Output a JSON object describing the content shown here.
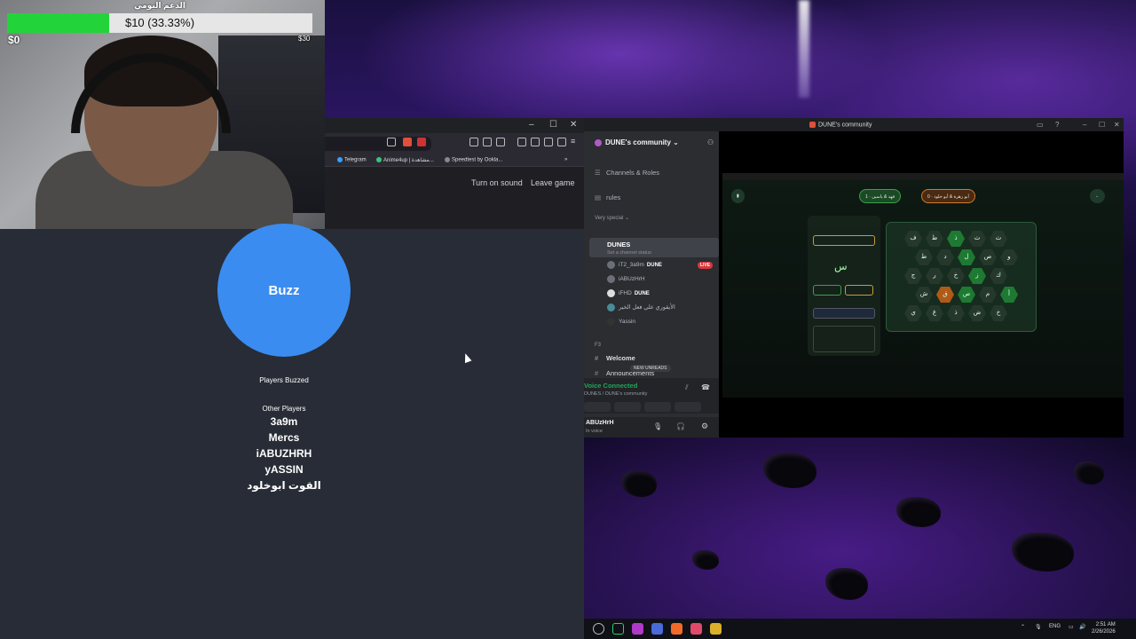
{
  "donation": {
    "title": "الدعم اليومي",
    "amount_text": "$10 (33.33%)",
    "progress_percent": 33.33,
    "min_label": "$0",
    "max_label": "$30"
  },
  "browser": {
    "bookmarks": [
      "Telegram",
      "Anime4up | مشاهدة...",
      "Speedtest by Ookla..."
    ],
    "window_controls": {
      "minimize": "–",
      "maximize": "☐",
      "close": "✕"
    }
  },
  "game": {
    "turn_on_sound": "Turn on sound",
    "leave_game": "Leave game",
    "buzz_label": "Buzz",
    "players_buzzed_label": "Players Buzzed",
    "other_players_label": "Other Players",
    "other_players": [
      "3a9m",
      "Mercs",
      "iABUZHRH",
      "yASSIN",
      "القوت ابوخلود"
    ]
  },
  "discord": {
    "window_title": "DUNE's community",
    "server_name": "DUNE's community",
    "channels_roles": "Channels & Roles",
    "rules": "rules",
    "category_very_special": "Very special",
    "active_channel": "DUNES",
    "channel_status_placeholder": "Set a channel status",
    "voice_users": [
      {
        "name": "iT2_3a9m",
        "tag": "DUNE",
        "live": true
      },
      {
        "name": "iABUzHrH",
        "tag": "",
        "live": false
      },
      {
        "name": "iFHD",
        "tag": "DUNE",
        "live": false
      },
      {
        "name": "الأيقوري علي فعل الخير",
        "tag": "",
        "live": false
      },
      {
        "name": "Yassin",
        "tag": "",
        "live": false
      }
    ],
    "live_badge": "LIVE",
    "category_f3": "F3",
    "channel_welcome": "Welcome",
    "channel_announcements": "Announcements",
    "new_unreads": "NEW UNREADS",
    "voice_connected": "Voice Connected",
    "voice_location": "DUNES / DUNE's community",
    "user_name": "ABUzHrH",
    "user_status": "In voice"
  },
  "stream": {
    "team_a": "أبو زهرة & أبو خلود",
    "team_b": "فهد & ياسين",
    "score_a": "0",
    "score_b": "1",
    "question_letter": "س",
    "hex_letters": [
      "ف",
      "ط",
      "ذ",
      "ث",
      "ث",
      "ط",
      "د",
      "ل",
      "ص",
      "و",
      "ج",
      "ر",
      "خ",
      "ز",
      "ك",
      "ش",
      "ق",
      "ص",
      "م",
      "أ",
      "ي",
      "غ",
      "ذ",
      "ض",
      "خ"
    ]
  },
  "taskbar": {
    "language": "ENG",
    "time": "2:51 AM",
    "date": "2/26/2026"
  },
  "colors": {
    "progress_green": "#22d43a",
    "buzz_blue": "#3b8cf0",
    "discord_voice_green": "#23a55a",
    "live_red": "#da373c"
  }
}
